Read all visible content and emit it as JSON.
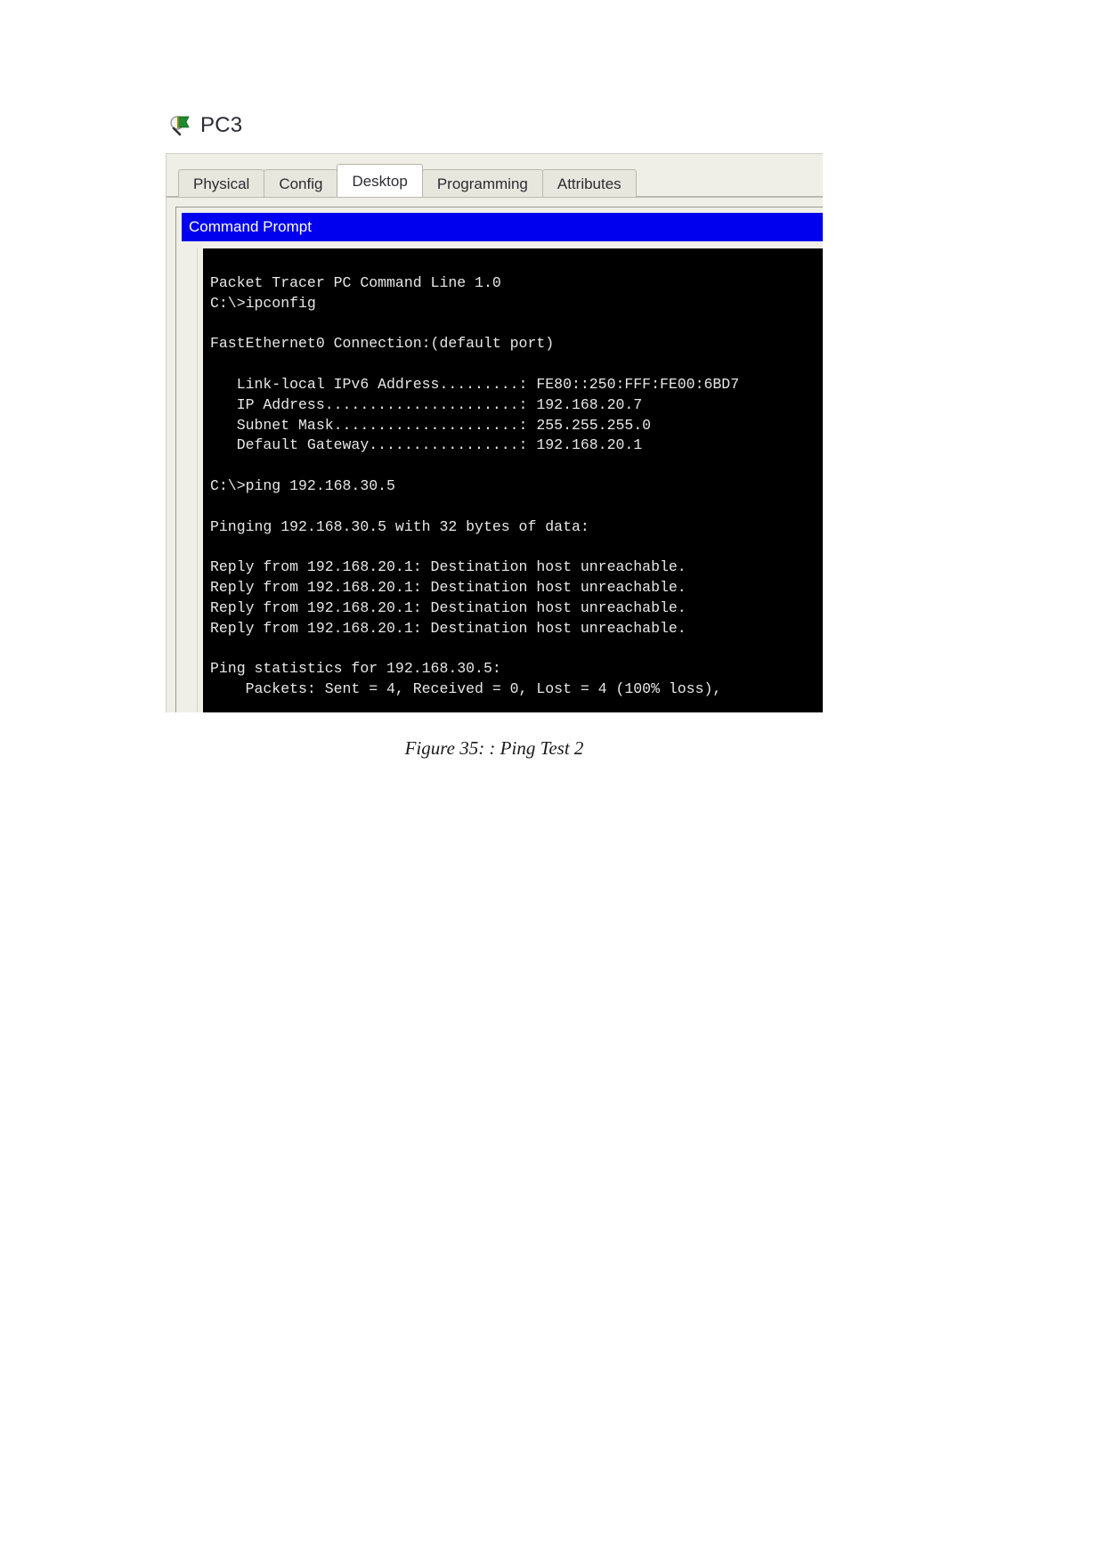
{
  "device": {
    "name": "PC3",
    "icon": "pc-magnifier-icon"
  },
  "tabs": [
    {
      "label": "Physical",
      "active": false
    },
    {
      "label": "Config",
      "active": false
    },
    {
      "label": "Desktop",
      "active": true
    },
    {
      "label": "Programming",
      "active": false
    },
    {
      "label": "Attributes",
      "active": false
    }
  ],
  "window": {
    "app_title": "Command Prompt"
  },
  "terminal": {
    "lines": [
      "Packet Tracer PC Command Line 1.0",
      "C:\\>ipconfig",
      "",
      "FastEthernet0 Connection:(default port)",
      "",
      "   Link-local IPv6 Address.........: FE80::250:FFF:FE00:6BD7",
      "   IP Address......................: 192.168.20.7",
      "   Subnet Mask.....................: 255.255.255.0",
      "   Default Gateway.................: 192.168.20.1",
      "",
      "C:\\>ping 192.168.30.5",
      "",
      "Pinging 192.168.30.5 with 32 bytes of data:",
      "",
      "Reply from 192.168.20.1: Destination host unreachable.",
      "Reply from 192.168.20.1: Destination host unreachable.",
      "Reply from 192.168.20.1: Destination host unreachable.",
      "Reply from 192.168.20.1: Destination host unreachable.",
      "",
      "Ping statistics for 192.168.30.5:",
      "    Packets: Sent = 4, Received = 0, Lost = 4 (100% loss),"
    ]
  },
  "caption": {
    "text": "Figure 35: : Ping Test 2"
  },
  "colors": {
    "titlebar": "#0000ee",
    "terminal_bg": "#000000",
    "terminal_fg": "#e8e8e8",
    "panel_bg": "#efefe7"
  }
}
